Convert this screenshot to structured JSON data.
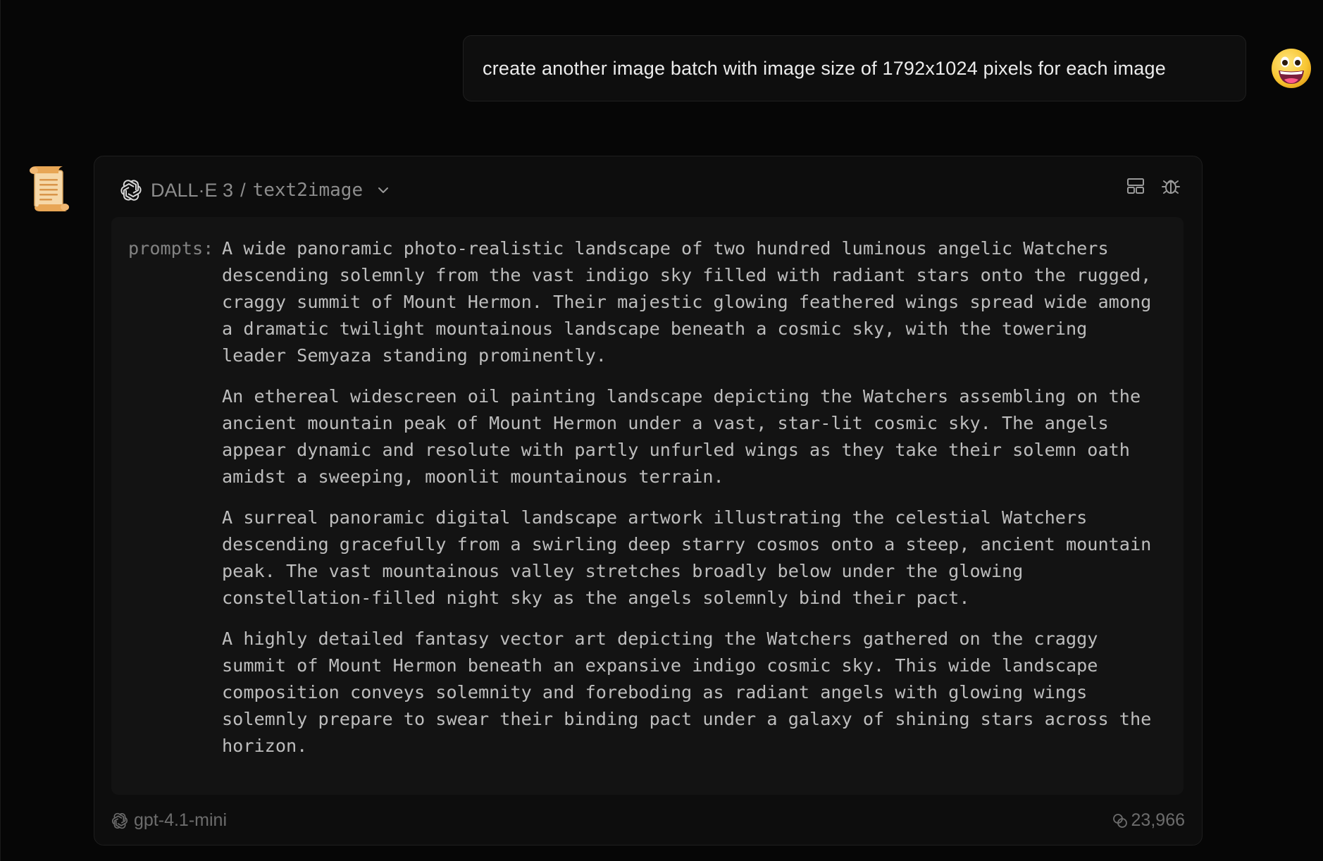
{
  "user_message": {
    "text": "create another image batch with image size of 1792x1024 pixels for each image",
    "avatar_icon": "grinning-face-emoji"
  },
  "assistant": {
    "avatar_icon": "scroll-emoji",
    "tool": {
      "name": "DALL·E 3",
      "separator": "/",
      "api": "text2image",
      "argument_key": "prompts:",
      "prompts": [
        "A wide panoramic photo-realistic landscape of two hundred luminous angelic Watchers descending solemnly from the vast indigo sky filled with radiant stars onto the rugged, craggy summit of Mount Hermon. Their majestic glowing feathered wings spread wide among a dramatic twilight mountainous landscape beneath a cosmic sky, with the towering leader Semyaza standing prominently.",
        "An ethereal widescreen oil painting landscape depicting the Watchers assembling on the ancient mountain peak of Mount Hermon under a vast, star-lit cosmic sky. The angels appear dynamic and resolute with partly unfurled wings as they take their solemn oath amidst a sweeping, moonlit mountainous terrain.",
        "A surreal panoramic digital landscape artwork illustrating the celestial Watchers descending gracefully from a swirling deep starry cosmos onto a steep, ancient mountain peak. The vast mountainous valley stretches broadly below under the glowing constellation-filled night sky as the angels solemnly bind their pact.",
        "A highly detailed fantasy vector art depicting the Watchers gathered on the craggy summit of Mount Hermon beneath an expansive indigo cosmic sky. This wide landscape composition conveys solemnity and foreboding as radiant angels with glowing wings solemnly prepare to swear their binding pact under a galaxy of shining stars across the horizon."
      ],
      "footer": {
        "model": "gpt-4.1-mini",
        "token_count": "23,966"
      }
    }
  },
  "colors": {
    "background": "#060606",
    "card": "#0d0d0d",
    "args_box": "#131313",
    "text_primary": "#ececec",
    "text_muted": "#8d8d8d"
  }
}
